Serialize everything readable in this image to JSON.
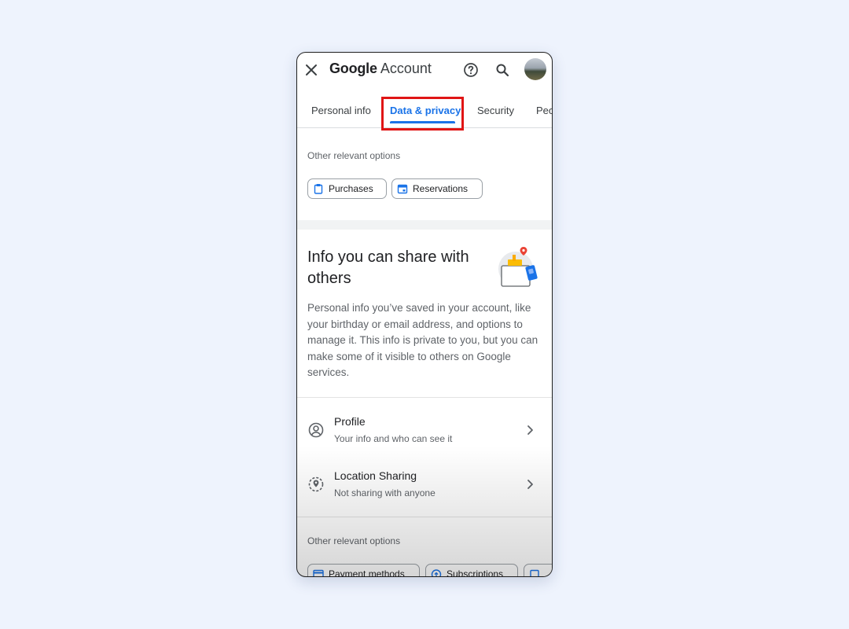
{
  "header": {
    "brand_google": "Google",
    "brand_account": "Account"
  },
  "tabs": [
    {
      "label": "Personal info"
    },
    {
      "label": "Data & privacy",
      "active": true
    },
    {
      "label": "Security"
    },
    {
      "label": "Peo"
    }
  ],
  "top_section": {
    "label": "Other relevant options",
    "chips": [
      {
        "label": "Purchases",
        "icon": "clipboard-icon"
      },
      {
        "label": "Reservations",
        "icon": "calendar-icon"
      }
    ]
  },
  "share_card": {
    "title": "Info you can share with others",
    "description": "Personal info you’ve saved in your account, like your birthday or email address, and options to manage it. This info is private to you, but you can make some of it visible to others on Google services."
  },
  "rows": [
    {
      "title": "Profile",
      "subtitle": "Your info and who can see it",
      "icon": "profile-icon"
    },
    {
      "title": "Location Sharing",
      "subtitle": "Not sharing with anyone",
      "icon": "location-sharing-icon"
    }
  ],
  "bottom_section": {
    "label": "Other relevant options",
    "chips": [
      {
        "label": "Payment methods",
        "icon": "card-icon"
      },
      {
        "label": "Subscriptions",
        "icon": "subscriptions-icon"
      }
    ]
  },
  "colors": {
    "accent": "#1a73e8",
    "highlight": "#e01515",
    "background": "#eef3fd"
  }
}
